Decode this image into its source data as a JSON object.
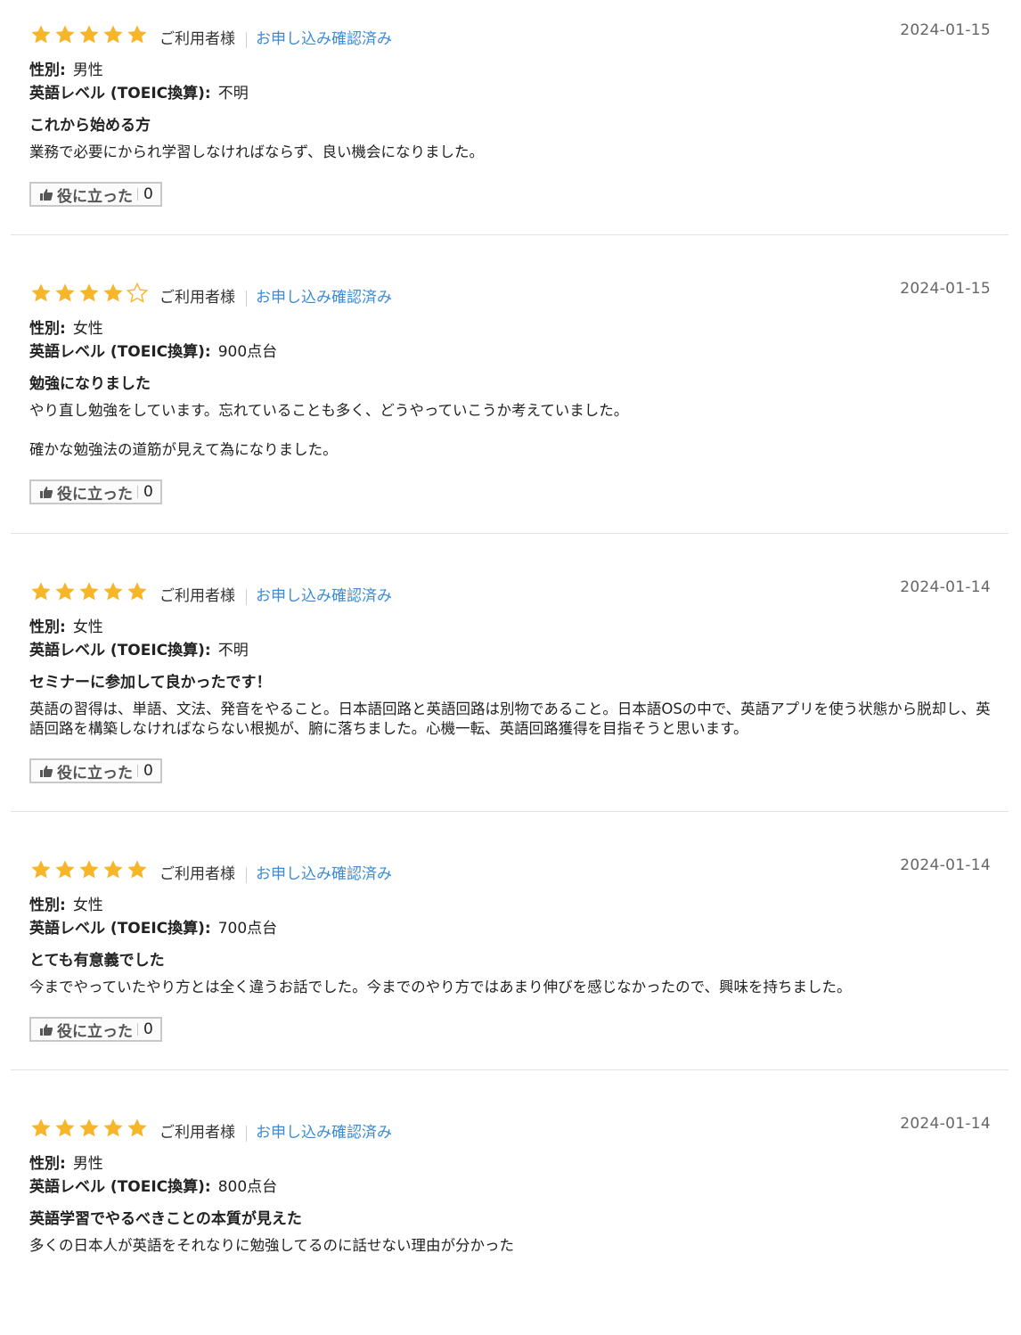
{
  "colors": {
    "star_filled": "#f7b52a",
    "star_empty_outline": "#f7b52a",
    "verified_link": "#3a8bd6",
    "divider": "#e3e3e3"
  },
  "labels": {
    "reviewer": "ご利用者様",
    "verified": "お申し込み確認済み",
    "gender_label": "性別:",
    "level_label": "英語レベル (TOEIC換算):",
    "helpful_label": "役に立った"
  },
  "reviews": [
    {
      "rating": 5,
      "date": "2024-01-15",
      "gender": "男性",
      "level": "不明",
      "title": "これから始める方",
      "body": [
        "業務で必要にかられ学習しなければならず、良い機会になりました。"
      ],
      "helpful_count": "0"
    },
    {
      "rating": 4,
      "date": "2024-01-15",
      "gender": "女性",
      "level": "900点台",
      "title": "勉強になりました",
      "body": [
        "やり直し勉強をしています。忘れていることも多く、どうやっていこうか考えていました。",
        "確かな勉強法の道筋が見えて為になりました。"
      ],
      "helpful_count": "0"
    },
    {
      "rating": 5,
      "date": "2024-01-14",
      "gender": "女性",
      "level": "不明",
      "title": "セミナーに参加して良かったです！",
      "body": [
        "英語の習得は、単語、文法、発音をやること。日本語回路と英語回路は別物であること。日本語OSの中で、英語アプリを使う状態から脱却し、英語回路を構築しなければならない根拠が、腑に落ちました。心機一転、英語回路獲得を目指そうと思います。"
      ],
      "helpful_count": "0"
    },
    {
      "rating": 5,
      "date": "2024-01-14",
      "gender": "女性",
      "level": "700点台",
      "title": "とても有意義でした",
      "body": [
        "今までやっていたやり方とは全く違うお話でした。今までのやり方ではあまり伸びを感じなかったので、興味を持ちました。"
      ],
      "helpful_count": "0"
    },
    {
      "rating": 5,
      "date": "2024-01-14",
      "gender": "男性",
      "level": "800点台",
      "title": "英語学習でやるべきことの本質が見えた",
      "body": [
        "多くの日本人が英語をそれなりに勉強してるのに話せない理由が分かった"
      ],
      "helpful_count": null
    }
  ]
}
